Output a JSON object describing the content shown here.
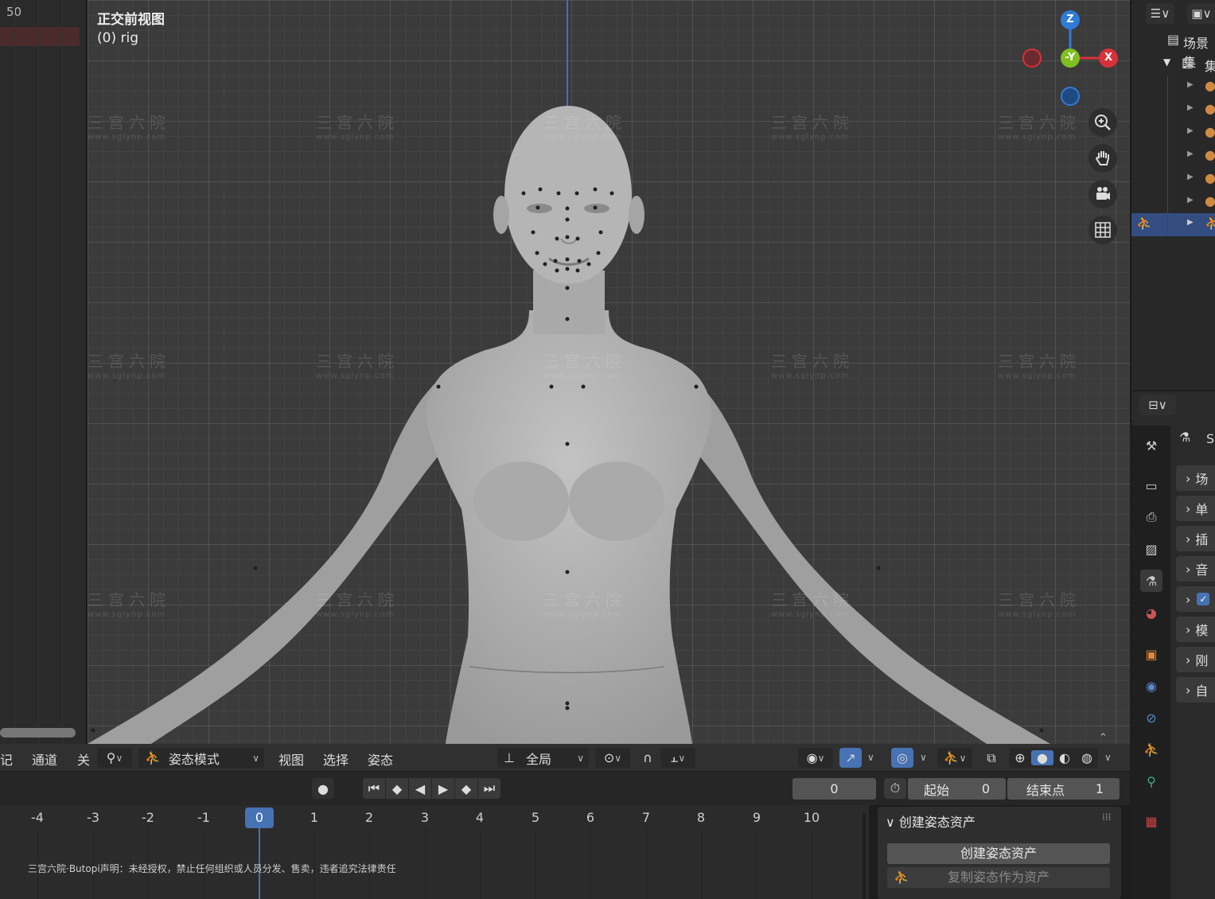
{
  "left_strip": {
    "frame_value": "50"
  },
  "viewport": {
    "view_name": "正交前视图",
    "object_label": "(0) rig",
    "gizmo": {
      "z": "Z",
      "y": "-Y",
      "x": "X"
    }
  },
  "header": {
    "mode": "姿态模式",
    "menus": [
      "视图",
      "选择",
      "姿态"
    ],
    "left_menus": [
      "记",
      "通道",
      "关"
    ],
    "transform_orientation": "全局"
  },
  "timeline": {
    "current_frame": "0",
    "start_label": "起始",
    "start_value": "0",
    "end_label": "结束点",
    "end_value": "1",
    "ticks": [
      "-4",
      "-3",
      "-2",
      "-1",
      "0",
      "1",
      "2",
      "3",
      "4",
      "5",
      "6",
      "7",
      "8",
      "9",
      "10"
    ],
    "playhead": "0"
  },
  "pose_panel": {
    "title": "创建姿态资产",
    "create_button": "创建姿态资产",
    "copy_button": "复制姿态作为资产"
  },
  "outliner": {
    "scene_collection": "场景集",
    "collection": "集"
  },
  "properties": {
    "header_text": "S",
    "rows": [
      "场",
      "单",
      "插",
      "音",
      "",
      "模",
      "刚",
      "自"
    ]
  },
  "copyright": "三宫六院·Butopi声明：未经授权，禁止任何组织或人员分发、售卖，违者追究法律责任",
  "watermark": {
    "cn": "三宫六院",
    "url": "www.sglynp.com"
  },
  "colors": {
    "accent": "#4772b3",
    "x_axis": "#d9303a",
    "y_axis": "#7fbf1f",
    "z_axis": "#2f7bd8"
  }
}
